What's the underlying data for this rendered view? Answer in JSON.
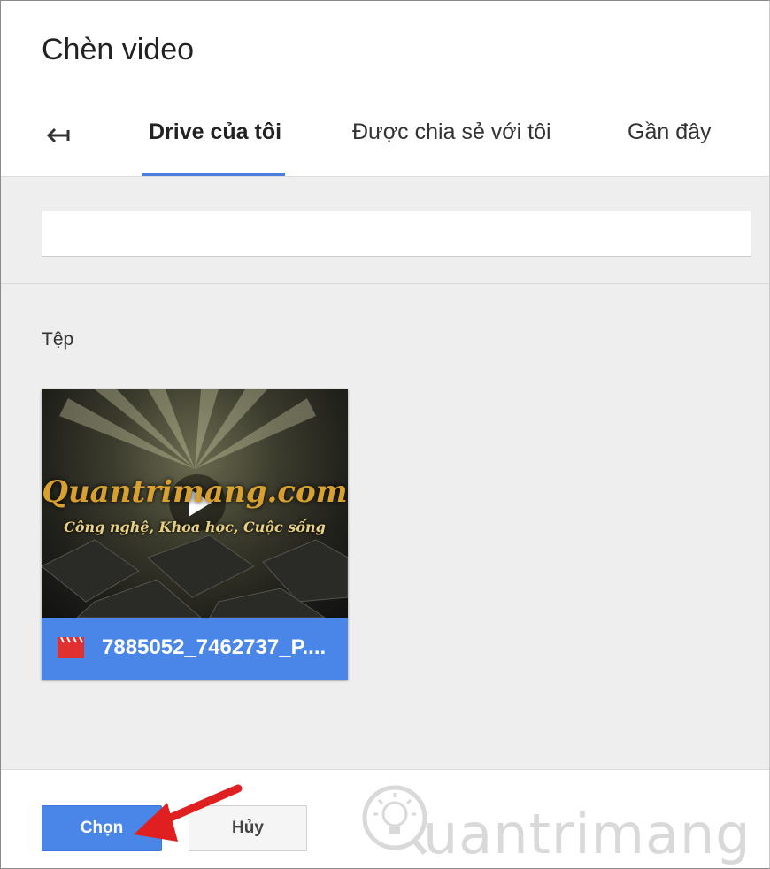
{
  "dialog": {
    "title": "Chèn video"
  },
  "tabs": [
    {
      "label": "Drive của tôi",
      "active": true
    },
    {
      "label": "Được chia sẻ với tôi",
      "active": false
    },
    {
      "label": "Gần đây",
      "active": false
    }
  ],
  "search": {
    "value": "",
    "placeholder": ""
  },
  "files_section": {
    "label": "Tệp"
  },
  "files": [
    {
      "name": "7885052_7462737_P....",
      "icon": "video-clapper-icon",
      "thumbnail_logo": "Quantrimang.com",
      "thumbnail_tagline": "Công nghệ, Khoa học, Cuộc sống"
    }
  ],
  "footer": {
    "select_label": "Chọn",
    "cancel_label": "Hủy"
  },
  "watermark": {
    "text": "uantrimang"
  },
  "colors": {
    "accent": "#4a86e8",
    "tab_underline": "#4a7fe0",
    "arrow": "#e02020",
    "film_icon": "#e03030"
  }
}
